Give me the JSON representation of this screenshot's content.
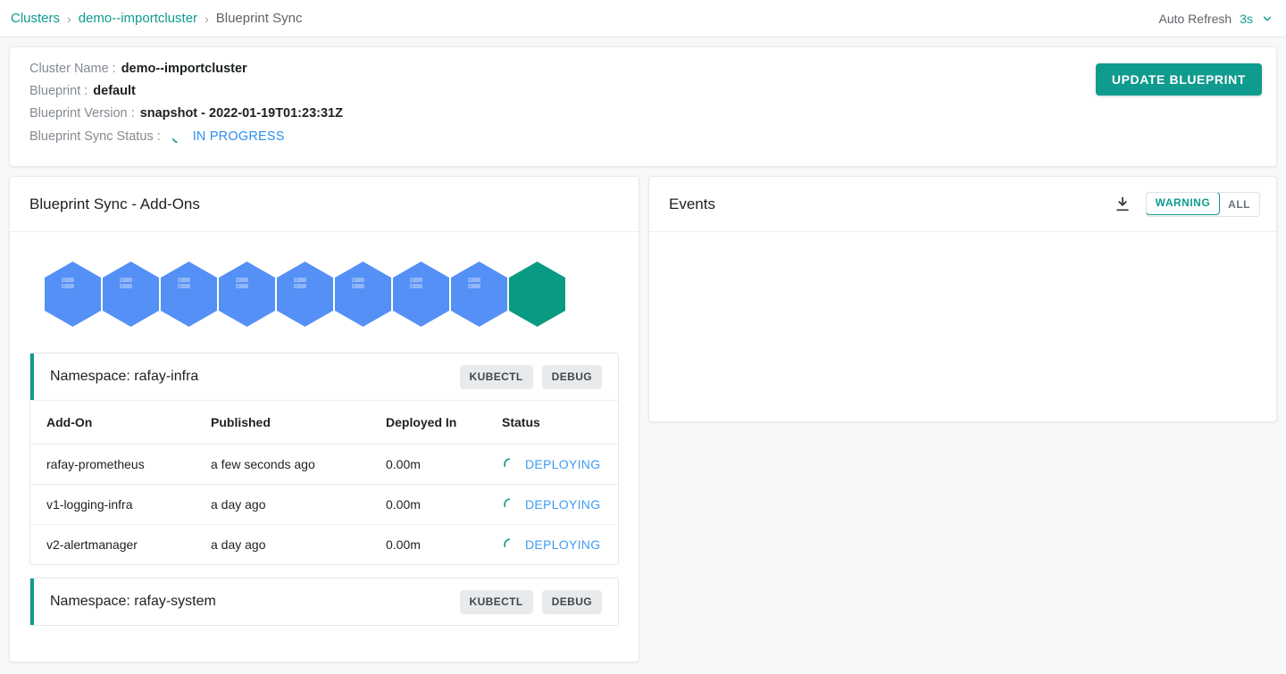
{
  "breadcrumb": {
    "items": [
      {
        "label": "Clusters",
        "type": "link"
      },
      {
        "label": "demo--importcluster",
        "type": "link"
      },
      {
        "label": "Blueprint Sync",
        "type": "current"
      }
    ],
    "separator": "›"
  },
  "topbar": {
    "auto_refresh_label": "Auto Refresh",
    "auto_refresh_value": "3s",
    "chevron_icon": "chevron-down-icon"
  },
  "cluster_info": {
    "rows": [
      {
        "label": "Cluster Name :",
        "value": "demo--importcluster"
      },
      {
        "label": "Blueprint :",
        "value": "default"
      },
      {
        "label": "Blueprint Version :",
        "value": "snapshot - 2022-01-19T01:23:31Z"
      }
    ],
    "sync_status_label": "Blueprint Sync Status :",
    "sync_status_value": "IN PROGRESS",
    "sync_status_icon": "spinner-icon",
    "update_button": "UPDATE BLUEPRINT"
  },
  "addons_panel": {
    "title": "Blueprint Sync - Add-Ons",
    "hexagons": [
      {
        "state": "pending",
        "icon": "server-stack-icon"
      },
      {
        "state": "pending",
        "icon": "server-stack-icon"
      },
      {
        "state": "pending",
        "icon": "server-stack-icon"
      },
      {
        "state": "pending",
        "icon": "server-stack-icon"
      },
      {
        "state": "pending",
        "icon": "server-stack-icon"
      },
      {
        "state": "pending",
        "icon": "server-stack-icon"
      },
      {
        "state": "pending",
        "icon": "server-stack-icon"
      },
      {
        "state": "pending",
        "icon": "server-stack-icon"
      },
      {
        "state": "complete",
        "icon": ""
      }
    ],
    "table_headers": [
      "Add-On",
      "Published",
      "Deployed In",
      "Status"
    ],
    "namespaces": [
      {
        "title": "Namespace: rafay-infra",
        "kubectl_label": "KUBECTL",
        "debug_label": "DEBUG",
        "rows": [
          {
            "addon": "rafay-prometheus",
            "published": "a few seconds ago",
            "deployed_in": "0.00m",
            "status": "DEPLOYING"
          },
          {
            "addon": "v1-logging-infra",
            "published": "a day ago",
            "deployed_in": "0.00m",
            "status": "DEPLOYING"
          },
          {
            "addon": "v2-alertmanager",
            "published": "a day ago",
            "deployed_in": "0.00m",
            "status": "DEPLOYING"
          }
        ]
      },
      {
        "title": "Namespace: rafay-system",
        "kubectl_label": "KUBECTL",
        "debug_label": "DEBUG",
        "rows": []
      }
    ]
  },
  "events_panel": {
    "title": "Events",
    "download_icon": "download-icon",
    "filters": [
      {
        "label": "WARNING",
        "active": true
      },
      {
        "label": "ALL",
        "active": false
      }
    ]
  },
  "colors": {
    "accent_teal": "#0f9b8e",
    "hex_pending_blue": "#5490f5",
    "hex_complete_teal": "#089a82",
    "status_blue": "#3f9cf5",
    "page_bg": "#f7f8f9"
  }
}
